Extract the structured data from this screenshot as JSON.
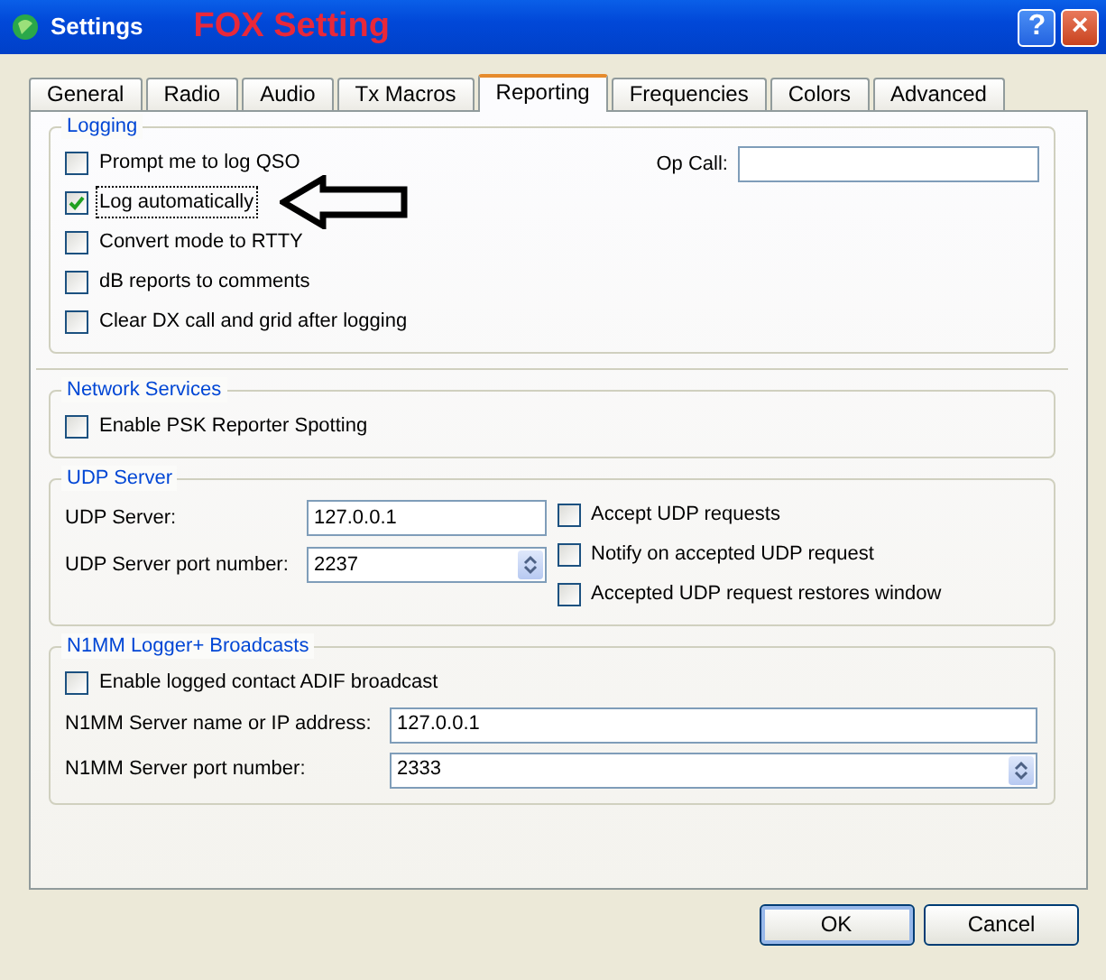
{
  "window": {
    "title": "Settings",
    "caption": "FOX Setting",
    "controls": [
      {
        "kind": "help",
        "label": "?"
      },
      {
        "kind": "close",
        "label": "×"
      }
    ]
  },
  "tabs": [
    {
      "label": "General",
      "selected": false
    },
    {
      "label": "Radio",
      "selected": false
    },
    {
      "label": "Audio",
      "selected": false
    },
    {
      "label": "Tx Macros",
      "selected": false
    },
    {
      "label": "Reporting",
      "selected": true
    },
    {
      "label": "Frequencies",
      "selected": false
    },
    {
      "label": "Colors",
      "selected": false
    },
    {
      "label": "Advanced",
      "selected": false
    }
  ],
  "logging": {
    "title": "Logging",
    "options": [
      {
        "label": "Prompt me to log QSO",
        "checked": false,
        "focused": false
      },
      {
        "label": "Log automatically",
        "checked": true,
        "focused": true
      },
      {
        "label": "Convert mode to RTTY",
        "checked": false,
        "focused": false
      },
      {
        "label": "dB reports to comments",
        "checked": false,
        "focused": false
      },
      {
        "label": "Clear DX call and grid after logging",
        "checked": false,
        "focused": false
      }
    ],
    "op_call": {
      "label": "Op Call:"
    }
  },
  "network_services": {
    "title": "Network Services",
    "options": [
      {
        "label": "Enable PSK Reporter Spotting",
        "checked": false
      }
    ]
  },
  "udp_server": {
    "title": "UDP Server",
    "fields": [
      {
        "label": "UDP Server:",
        "value": "127.0.0.1",
        "kind": "text"
      },
      {
        "label": "UDP Server port number:",
        "value": "2237",
        "kind": "spin"
      }
    ],
    "options": [
      {
        "label": "Accept UDP requests",
        "checked": false
      },
      {
        "label": "Notify on accepted UDP request",
        "checked": false
      },
      {
        "label": "Accepted UDP request restores window",
        "checked": false
      }
    ]
  },
  "n1mm": {
    "title": "N1MM Logger+  Broadcasts",
    "options": [
      {
        "label": "Enable logged contact ADIF broadcast",
        "checked": false
      }
    ],
    "fields": [
      {
        "label": "N1MM Server name or IP address:",
        "value": "127.0.0.1",
        "kind": "text"
      },
      {
        "label": "N1MM Server port number:",
        "value": "2333",
        "kind": "spin"
      }
    ]
  },
  "buttons": [
    {
      "label": "OK",
      "default": true
    },
    {
      "label": "Cancel",
      "default": false
    }
  ]
}
